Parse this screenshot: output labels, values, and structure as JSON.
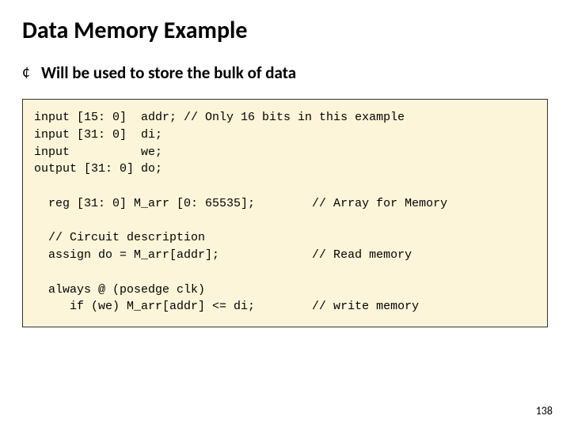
{
  "title": "Data Memory Example",
  "bullet": {
    "marker": "¢",
    "text": "Will be used to store the bulk of data"
  },
  "code": "input [15: 0]  addr; // Only 16 bits in this example\ninput [31: 0]  di;\ninput          we;\noutput [31: 0] do;\n\n  reg [31: 0] M_arr [0: 65535];        // Array for Memory\n\n  // Circuit description\n  assign do = M_arr[addr];             // Read memory\n\n  always @ (posedge clk)\n     if (we) M_arr[addr] <= di;        // write memory",
  "page_number": "138"
}
